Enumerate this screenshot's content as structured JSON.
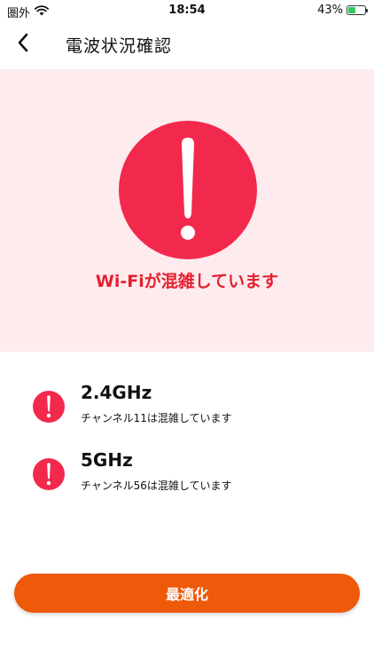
{
  "status_bar": {
    "carrier": "圏外",
    "time": "18:54",
    "battery_percent": "43%",
    "battery_level": 0.43,
    "icons": [
      "wifi-icon",
      "battery-charging-icon"
    ]
  },
  "header": {
    "title": "電波状況確認",
    "back_icon": "chevron-left-icon"
  },
  "hero": {
    "message": "Wi-Fiが混雑しています",
    "icon": "exclamation-icon",
    "colors": {
      "background": "#fdebee",
      "alert": "#f2294d",
      "message": "#e4202f"
    }
  },
  "bands": [
    {
      "name": "2.4GHz",
      "status": "チャンネル11は混雑しています",
      "icon": "exclamation-icon"
    },
    {
      "name": "5GHz",
      "status": "チャンネル56は混雑しています",
      "icon": "exclamation-icon"
    }
  ],
  "action": {
    "label": "最適化",
    "color": "#ee5a0a"
  }
}
